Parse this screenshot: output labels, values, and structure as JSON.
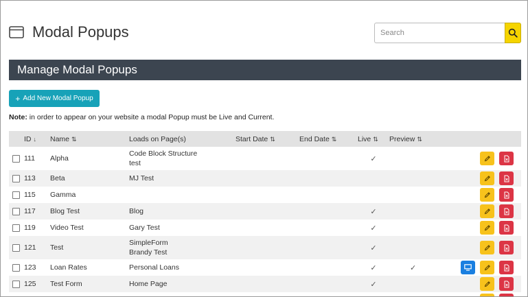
{
  "header": {
    "title": "Modal Popups",
    "search_placeholder": "Search"
  },
  "section": {
    "title": "Manage Modal Popups"
  },
  "add_button_label": "Add New Modal Popup",
  "note": {
    "bold": "Note:",
    "text": " in order to appear on your website a modal Popup must be Live and Current."
  },
  "table": {
    "columns": {
      "id": "ID",
      "name": "Name",
      "loads": "Loads on Page(s)",
      "start": "Start Date",
      "end": "End Date",
      "live": "Live",
      "preview": "Preview"
    },
    "rows": [
      {
        "id": "111",
        "name": "Alpha",
        "loads": [
          "Code Block Structure",
          "test"
        ],
        "start": "",
        "end": "",
        "live": true,
        "preview": false,
        "preview_button": false
      },
      {
        "id": "113",
        "name": "Beta",
        "loads": [
          "MJ Test"
        ],
        "start": "",
        "end": "",
        "live": false,
        "preview": false,
        "preview_button": false
      },
      {
        "id": "115",
        "name": "Gamma",
        "loads": [],
        "start": "",
        "end": "",
        "live": false,
        "preview": false,
        "preview_button": false
      },
      {
        "id": "117",
        "name": "Blog Test",
        "loads": [
          "Blog"
        ],
        "start": "",
        "end": "",
        "live": true,
        "preview": false,
        "preview_button": false
      },
      {
        "id": "119",
        "name": "Video Test",
        "loads": [
          "Gary Test"
        ],
        "start": "",
        "end": "",
        "live": true,
        "preview": false,
        "preview_button": false
      },
      {
        "id": "121",
        "name": "Test",
        "loads": [
          "SimpleForm",
          "Brandy Test"
        ],
        "start": "",
        "end": "",
        "live": true,
        "preview": false,
        "preview_button": false
      },
      {
        "id": "123",
        "name": "Loan Rates",
        "loads": [
          "Personal Loans"
        ],
        "start": "",
        "end": "",
        "live": true,
        "preview": true,
        "preview_button": true
      },
      {
        "id": "125",
        "name": "Test Form",
        "loads": [
          "Home Page"
        ],
        "start": "",
        "end": "",
        "live": true,
        "preview": false,
        "preview_button": false
      },
      {
        "id": "",
        "name": "",
        "loads": [],
        "start": "",
        "end": "",
        "live": false,
        "preview": false,
        "preview_button": false
      }
    ]
  },
  "icons": {
    "title": "window-icon",
    "search": "search-icon",
    "edit": "pencil-icon",
    "delete": "delete-file-icon",
    "preview": "monitor-icon",
    "live": "check-icon",
    "sort_id": "arrow-down-icon",
    "sort": "sort-arrows-icon"
  },
  "glyphs": {
    "plus": "+",
    "sort_down": "↓",
    "sort_both": "⇅",
    "check": "✓"
  },
  "colors": {
    "header_bar": "#3c4550",
    "add_button": "#17a2b8",
    "search_button": "#f5d400",
    "edit_button": "#f7c21c",
    "delete_button": "#dc3545",
    "preview_button": "#1a7fe0"
  }
}
